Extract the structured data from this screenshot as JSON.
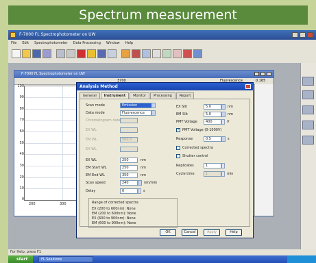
{
  "banner": {
    "title": "Spectrum measurement"
  },
  "app": {
    "title": "F-7000 FL Spectrophotometer on UW",
    "menu": [
      "File",
      "Edit",
      "Spectrophotometer",
      "Data Processing",
      "Window",
      "Help"
    ],
    "status": "For Help, press F1",
    "taskbar": {
      "start": "start",
      "task": "FL Solutions",
      "clock": ""
    }
  },
  "child": {
    "title": "F-7000 FL Spectrophotometer on UW",
    "readout": "3700",
    "wl_label": "Fluorescence",
    "wl_value": "0.165"
  },
  "plot": {
    "yticks": [
      "100",
      "90",
      "80",
      "70",
      "60",
      "50",
      "40",
      "30",
      "20",
      "10",
      "0"
    ],
    "xticks": [
      "200",
      "300",
      "400",
      "500",
      "600",
      "700",
      "800"
    ]
  },
  "dialog": {
    "title": "Analysis Method",
    "tabs": [
      "General",
      "Instrument",
      "Monitor",
      "Processing",
      "Report"
    ],
    "active_tab": "Instrument",
    "left": {
      "scan_mode": {
        "label": "Scan mode",
        "value": "Emission"
      },
      "data_mode": {
        "label": "Data mode",
        "value": "Fluorescence"
      },
      "chrom": {
        "label": "Chromatogram data",
        "value": ""
      },
      "em_wl": {
        "label": "EM WL",
        "value": "500.0"
      },
      "ex_wl_top": {
        "label": "EX WL",
        "value": ""
      },
      "ex_wl_bottom": {
        "label": "EX WL",
        "value": ""
      },
      "ex_wl": {
        "label": "EX WL",
        "value": "250"
      },
      "em_start": {
        "label": "EM Start WL",
        "value": "250"
      },
      "em_end": {
        "label": "EM End WL",
        "value": "350"
      },
      "scan_speed": {
        "label": "Scan speed",
        "value": "240",
        "unit": "nm/min"
      },
      "delay": {
        "label": "Delay",
        "value": "0",
        "unit": "s"
      }
    },
    "right": {
      "ex_slit": {
        "label": "EX Slit",
        "value": "5.0",
        "unit": "nm"
      },
      "em_slit": {
        "label": "EM Slit",
        "value": "5.0",
        "unit": "nm"
      },
      "pmt_voltage": {
        "label": "PMT Voltage",
        "value": "400",
        "unit": "V"
      },
      "pmt_check": {
        "label": "PMT Voltage (0-1000V)",
        "checked": true
      },
      "response": {
        "label": "Response",
        "value": "0.5",
        "unit": "s"
      },
      "corrected": {
        "label": "Corrected spectra",
        "checked": false
      },
      "shutter": {
        "label": "Shutter control",
        "checked": false
      },
      "replicates": {
        "label": "Replicates",
        "value": "1"
      },
      "cycle": {
        "label": "Cycle time",
        "value": "1",
        "unit": "min"
      }
    },
    "range": {
      "title": "Range of corrected spectra",
      "lines": [
        "EX (200 to 600nm): None",
        "EM (200 to 600nm): None",
        "EX (600 to 900nm): None",
        "EM (600 to 900nm): None"
      ]
    },
    "buttons": [
      "OK",
      "Cancel",
      "Apply",
      "Help"
    ]
  }
}
